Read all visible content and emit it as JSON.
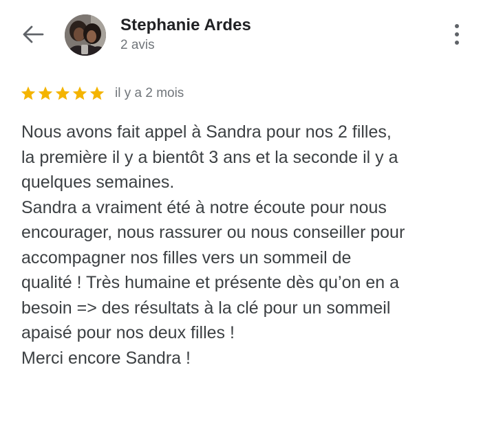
{
  "header": {
    "back_icon": "arrow-back-icon",
    "author_name": "Stephanie Ardes",
    "author_meta": "2 avis",
    "more_icon": "more-vert-icon"
  },
  "review": {
    "rating": 5,
    "rating_max": 5,
    "star_color": "#f4b400",
    "date": "il y a 2 mois",
    "lines": [
      "Nous avons fait appel à Sandra pour nos 2 filles,",
      "la première il y a bientôt 3 ans et la seconde il y a",
      "quelques semaines.",
      "Sandra a vraiment été à notre écoute pour nous",
      "encourager, nous rassurer ou nous conseiller pour",
      "accompagner nos filles vers un sommeil de",
      "qualité ! Très humaine et présente dès qu’on en a",
      "besoin => des résultats à la clé pour un sommeil",
      "apaisé pour nos deux filles !",
      "Merci encore Sandra !"
    ]
  }
}
